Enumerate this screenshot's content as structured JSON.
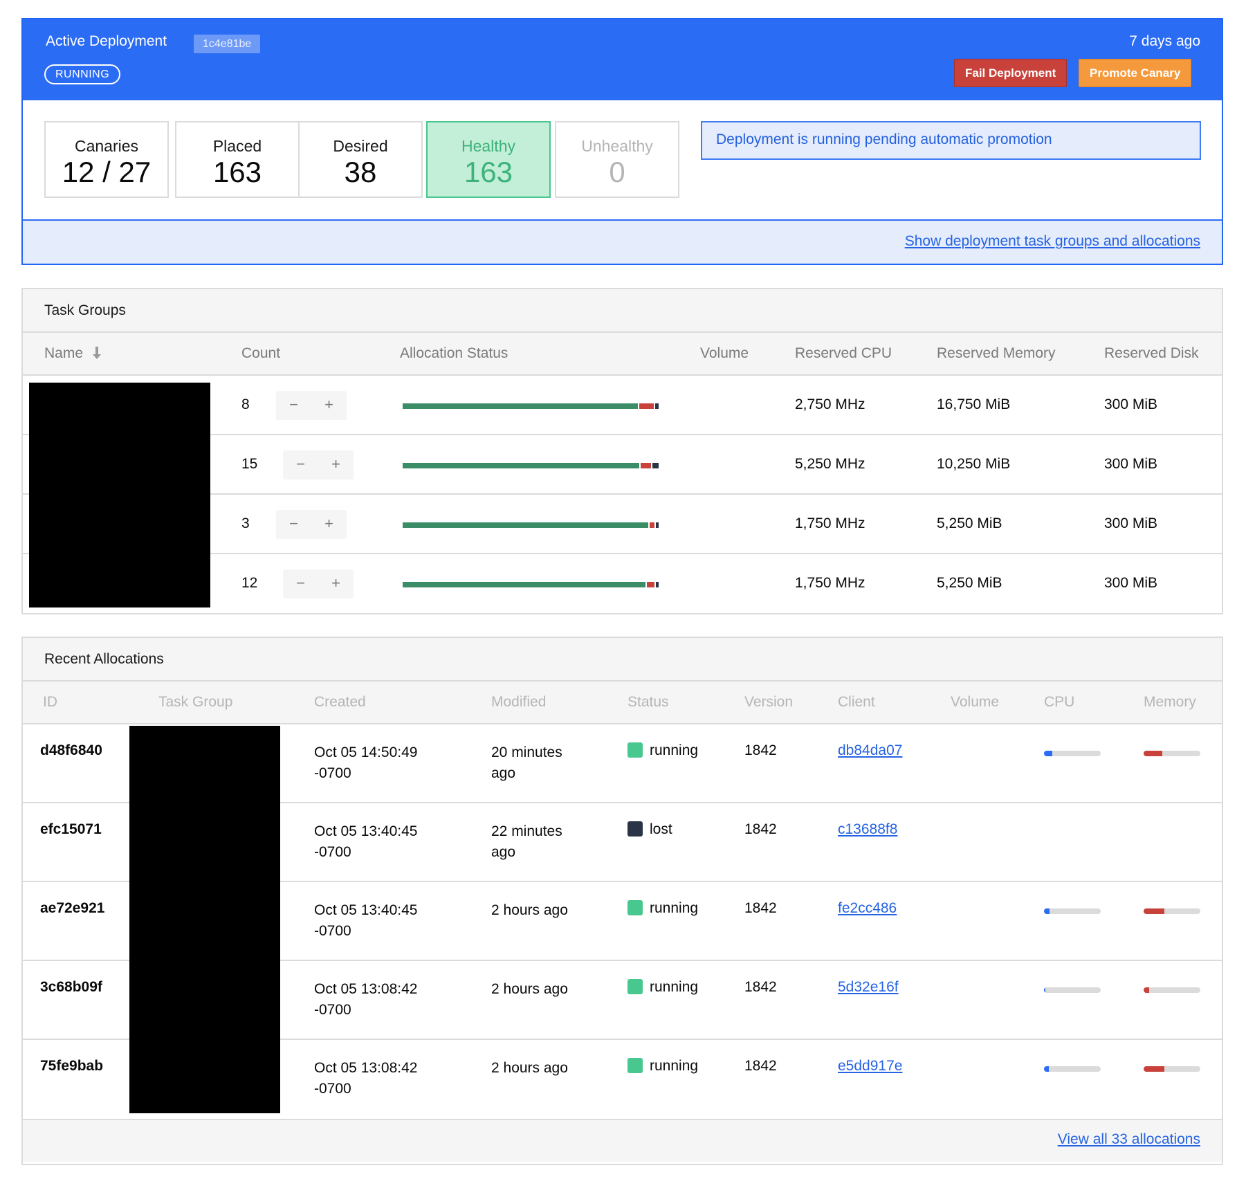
{
  "deployment": {
    "title": "Active Deployment",
    "id": "1c4e81be",
    "status": "RUNNING",
    "time": "7 days ago",
    "fail_label": "Fail Deployment",
    "promote_label": "Promote Canary",
    "stats": {
      "canaries": {
        "label": "Canaries",
        "value": "12 / 27"
      },
      "placed": {
        "label": "Placed",
        "value": "163"
      },
      "desired": {
        "label": "Desired",
        "value": "38"
      },
      "healthy": {
        "label": "Healthy",
        "value": "163"
      },
      "unhealthy": {
        "label": "Unhealthy",
        "value": "0"
      }
    },
    "notice": "Deployment is running pending automatic promotion",
    "show_link": "Show deployment task groups and allocations"
  },
  "task_groups": {
    "title": "Task Groups",
    "columns": {
      "name": "Name",
      "count": "Count",
      "alloc_status": "Allocation Status",
      "volume": "Volume",
      "cpu": "Reserved CPU",
      "memory": "Reserved Memory",
      "disk": "Reserved Disk"
    },
    "stepper": {
      "minus": "−",
      "plus": "+"
    },
    "rows": [
      {
        "count": "8",
        "cpu": "2,750 MHz",
        "memory": "16,750 MiB",
        "disk": "300 MiB",
        "bar": {
          "running": 0.92,
          "failed": 0.06,
          "lost": 0.02
        }
      },
      {
        "count": "15",
        "cpu": "5,250 MHz",
        "memory": "10,250 MiB",
        "disk": "300 MiB",
        "bar": {
          "running": 0.925,
          "failed": 0.045,
          "lost": 0.03
        }
      },
      {
        "count": "3",
        "cpu": "1,750 MHz",
        "memory": "5,250 MiB",
        "disk": "300 MiB",
        "bar": {
          "running": 0.96,
          "failed": 0.025,
          "lost": 0.015
        }
      },
      {
        "count": "12",
        "cpu": "1,750 MHz",
        "memory": "5,250 MiB",
        "disk": "300 MiB",
        "bar": {
          "running": 0.95,
          "failed": 0.035,
          "lost": 0.015
        }
      }
    ]
  },
  "recent_allocations": {
    "title": "Recent Allocations",
    "columns": {
      "id": "ID",
      "task_group": "Task Group",
      "created": "Created",
      "modified": "Modified",
      "status": "Status",
      "version": "Version",
      "client": "Client",
      "volume": "Volume",
      "cpu": "CPU",
      "memory": "Memory"
    },
    "rows": [
      {
        "id": "d48f6840",
        "created_1": "Oct 05 14:50:49",
        "created_2": "-0700",
        "modified_1": "20 minutes",
        "modified_2": "ago",
        "status": "running",
        "status_color": "#48c78e",
        "version": "1842",
        "client": "db84da07",
        "cpu": 0.15,
        "memory": 0.33
      },
      {
        "id": "efc15071",
        "created_1": "Oct 05 13:40:45",
        "created_2": "-0700",
        "modified_1": "22 minutes",
        "modified_2": "ago",
        "status": "lost",
        "status_color": "#2a3446",
        "version": "1842",
        "client": "c13688f8",
        "cpu": null,
        "memory": null
      },
      {
        "id": "ae72e921",
        "created_1": "Oct 05 13:40:45",
        "created_2": "-0700",
        "modified_1": "2 hours ago",
        "modified_2": "",
        "status": "running",
        "status_color": "#48c78e",
        "version": "1842",
        "client": "fe2cc486",
        "cpu": 0.1,
        "memory": 0.36
      },
      {
        "id": "3c68b09f",
        "created_1": "Oct 05 13:08:42",
        "created_2": "-0700",
        "modified_1": "2 hours ago",
        "modified_2": "",
        "status": "running",
        "status_color": "#48c78e",
        "version": "1842",
        "client": "5d32e16f",
        "cpu": 0.03,
        "memory": 0.1
      },
      {
        "id": "75fe9bab",
        "created_1": "Oct 05 13:08:42",
        "created_2": "-0700",
        "modified_1": "2 hours ago",
        "modified_2": "",
        "status": "running",
        "status_color": "#48c78e",
        "version": "1842",
        "client": "e5dd917e",
        "cpu": 0.08,
        "memory": 0.36
      }
    ],
    "view_all": "View all 33 allocations"
  },
  "colors": {
    "primary": "#2b6cf5",
    "danger": "#c8423b",
    "warning": "#f59a3c",
    "success": "#48c78e",
    "running_bar": "#3a8d66",
    "failed_bar": "#c8423b",
    "lost_bar": "#2a3446",
    "cpu_meter": "#2b6cf5",
    "memory_meter": "#c8423b"
  }
}
